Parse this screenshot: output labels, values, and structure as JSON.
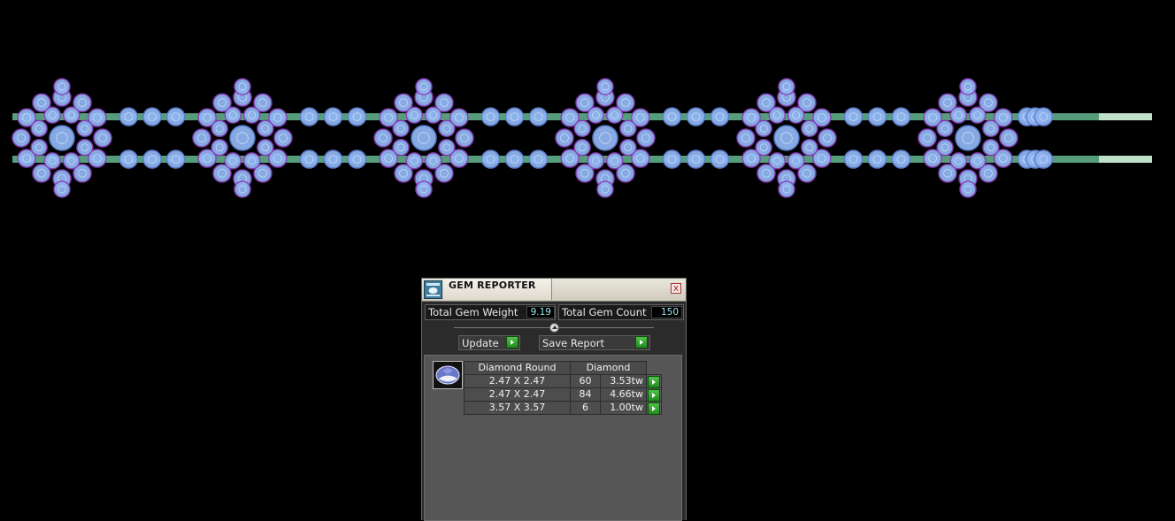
{
  "panel": {
    "title": "GEM REPORTER",
    "close_glyph": "x",
    "total_weight_label": "Total Gem Weight",
    "total_weight_value": "9.19",
    "total_count_label": "Total Gem Count",
    "total_count_value": "150",
    "update_label": "Update",
    "save_label": "Save Report",
    "gem_icon": "oval-gem-icon",
    "table": {
      "header_shape": "Diamond Round",
      "header_material": "Diamond",
      "rows": [
        {
          "size": "2.47 X 2.47",
          "count": "60",
          "weight": "3.53tw"
        },
        {
          "size": "2.47 X 2.47",
          "count": "84",
          "weight": "4.66tw"
        },
        {
          "size": "3.57 X 3.57",
          "count": "6",
          "weight": "1.00tw"
        }
      ]
    }
  },
  "colors": {
    "gem_fill": "#8fb4f0",
    "gem_prong": "#8a3fb8",
    "rail_green": "#5fae8a",
    "panel_bg": "#2b2b2b",
    "value_text": "#9ee4f0",
    "play_green": "#2ea22a"
  }
}
